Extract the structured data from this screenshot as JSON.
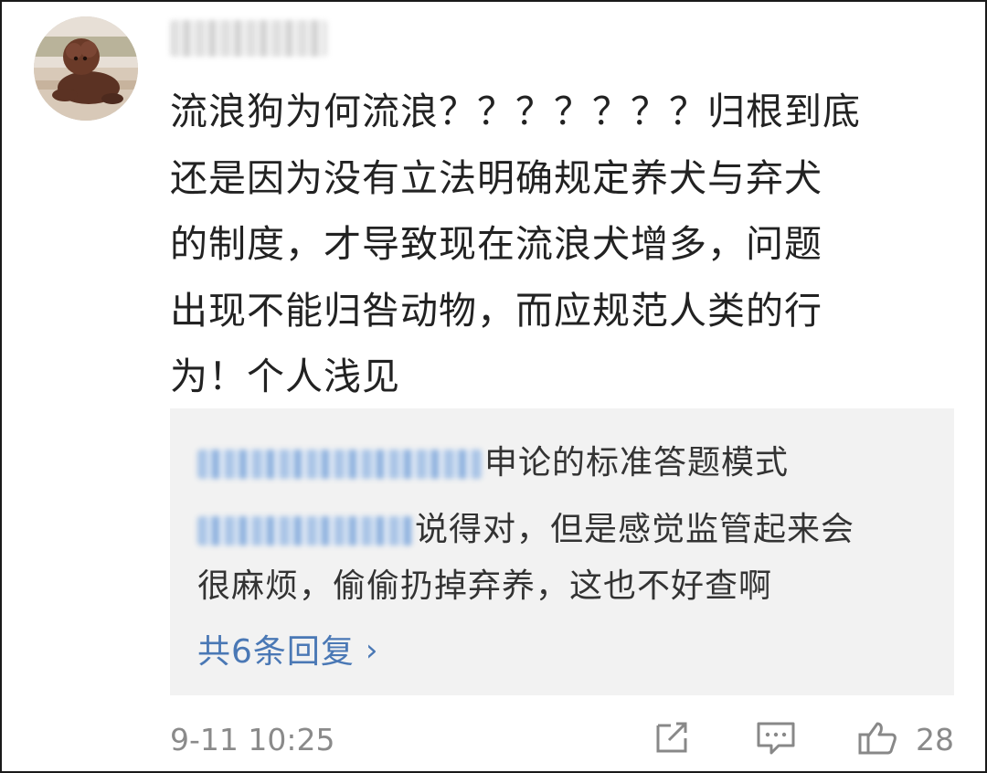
{
  "comment": {
    "avatar_icon": "dog-photo-avatar",
    "username": "",
    "lines": [
      "流浪狗为何流浪？？？？？？？归根到底",
      "还是因为没有立法明确规定养犬与弃犬",
      "的制度，才导致现在流浪犬增多，问题",
      "出现不能归咎动物，而应规范人类的行",
      "为！个人浅见"
    ],
    "timestamp": "9-11 10:25",
    "like_count": "28"
  },
  "replies": {
    "items": [
      {
        "text": "申论的标准答题模式"
      },
      {
        "text": "说得对，但是感觉监管起来会"
      },
      {
        "text": "很麻烦，偷偷扔掉弃养，这也不好查啊"
      }
    ],
    "more_label": "共6条回复",
    "chevron_icon": "chevron-right-icon"
  },
  "actions": {
    "share_icon": "share-icon",
    "comment_icon": "comment-icon",
    "like_icon": "thumbs-up-icon"
  },
  "colors": {
    "link": "#4a78b5",
    "reply_bg": "#f2f2f2",
    "meta": "#8a8a8a"
  }
}
